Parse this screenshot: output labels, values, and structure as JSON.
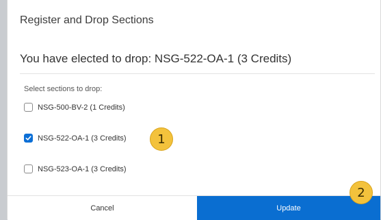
{
  "dialog": {
    "title": "Register and Drop Sections",
    "subtitle": "You have elected to drop: NSG-522-OA-1 (3 Credits)",
    "select_label": "Select sections to drop:",
    "options": [
      {
        "label": "NSG-500-BV-2 (1 Credits)",
        "checked": false
      },
      {
        "label": "NSG-522-OA-1 (3 Credits)",
        "checked": true
      },
      {
        "label": "NSG-523-OA-1 (3 Credits)",
        "checked": false
      }
    ],
    "callouts": [
      "1",
      "2"
    ],
    "buttons": {
      "cancel": "Cancel",
      "update": "Update"
    }
  },
  "colors": {
    "primary": "#0a6ed1",
    "callout": "#f3c23c"
  }
}
